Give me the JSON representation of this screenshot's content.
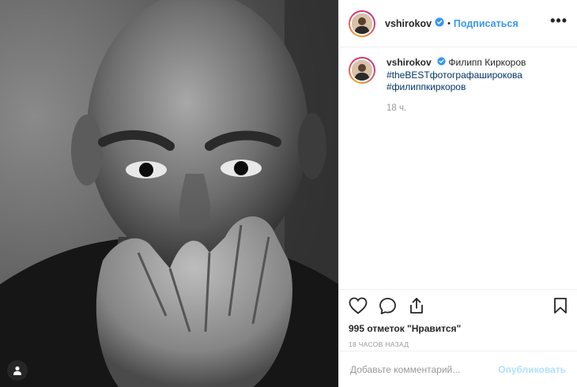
{
  "post": {
    "username": "vshirokov",
    "follow_label": "Подписаться",
    "separator": "•",
    "more_label": "•••",
    "caption_user": "vshirokov",
    "caption_text": "Филипп Киркоров",
    "hashtags": [
      "#theBESTфотографаширокова",
      "#филиппкиркоров"
    ],
    "time_ago": "18 ч.",
    "likes_label": "995 отметок \"Нравится\"",
    "timestamp": "18 ЧАСОВ НАЗАД",
    "comment_placeholder": "Добавьте комментарий...",
    "publish_label": "Опубликовать"
  },
  "icons": {
    "like": "heart-icon",
    "comment": "comment-icon",
    "share": "share-icon",
    "save": "bookmark-icon",
    "verified": "verified-badge-icon",
    "user_tag": "user-tag-icon"
  },
  "colors": {
    "accent": "#3897f0",
    "hashtag": "#003569",
    "publish_disabled": "#b2dffc",
    "muted": "#999999",
    "border": "#efefef"
  }
}
